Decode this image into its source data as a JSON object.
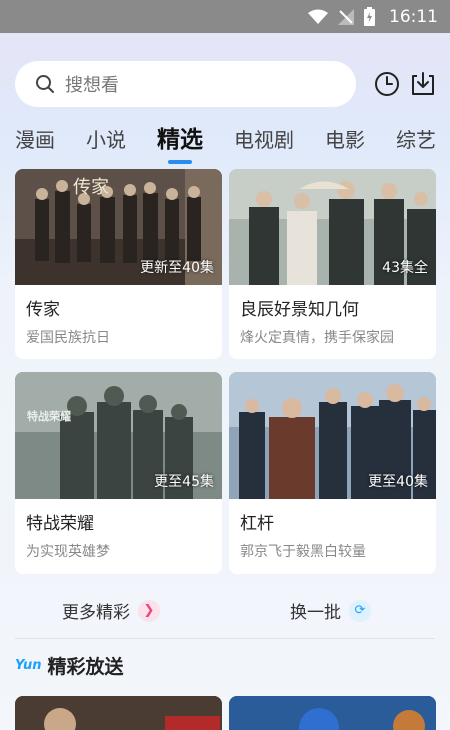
{
  "status_bar": {
    "time": "16:11"
  },
  "search": {
    "placeholder": "搜想看"
  },
  "tabs": [
    {
      "label": "漫画"
    },
    {
      "label": "小说"
    },
    {
      "label": "精选",
      "active": true
    },
    {
      "label": "电视剧"
    },
    {
      "label": "电影"
    },
    {
      "label": "综艺"
    }
  ],
  "cards": [
    {
      "title": "传家",
      "subtitle": "爱国民族抗日",
      "badge": "更新至40集"
    },
    {
      "title": "良辰好景知几何",
      "subtitle": "烽火定真情，携手保家园",
      "badge": "43集全"
    },
    {
      "title": "特战荣耀",
      "subtitle": "为实现英雄梦",
      "badge": "更至45集"
    },
    {
      "title": "杠杆",
      "subtitle": "郭京飞于毅黑白较量",
      "badge": "更至40集"
    }
  ],
  "actions": {
    "more": "更多精彩",
    "refresh": "换一批"
  },
  "section": {
    "logo": "Yun",
    "title": "精彩放送"
  },
  "colors": {
    "accent": "#2b8cf0",
    "more_icon": "#e8477a",
    "refresh_icon": "#1aa0ff"
  }
}
